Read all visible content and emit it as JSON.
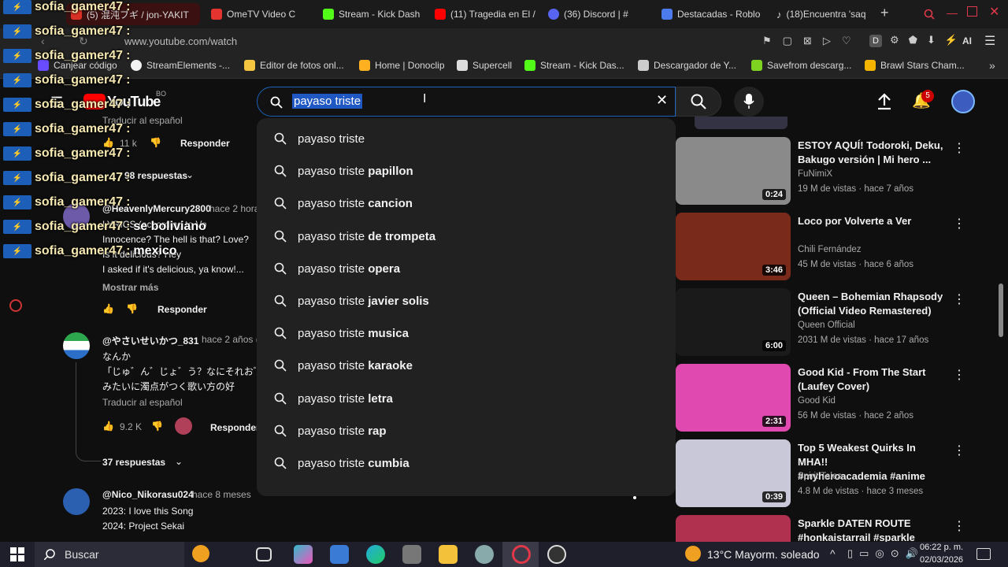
{
  "tabs": [
    {
      "label": "(5) 混沌ブギ / jon-YAKIT",
      "color": "#d93025"
    },
    {
      "label": "OmeTV Video C",
      "color": "#e3342f"
    },
    {
      "label": "Stream - Kick Dash",
      "color": "#53fc18"
    },
    {
      "label": "(11) Tragedia en El /",
      "color": "#ff0000"
    },
    {
      "label": "(36) Discord | #",
      "color": "#5865f2"
    },
    {
      "label": "Destacadas - Roblo",
      "color": "#4b7bec"
    },
    {
      "label": "(18)Encuentra 'saq",
      "color": "#111111"
    }
  ],
  "url": "www.youtube.com/watch",
  "bookmarks": [
    {
      "label": "Canjear código"
    },
    {
      "label": "StreamElements -..."
    },
    {
      "label": "Editor de fotos onl..."
    },
    {
      "label": "Home | Donoclip"
    },
    {
      "label": "Supercell"
    },
    {
      "label": "Stream - Kick Das..."
    },
    {
      "label": "Descargador de Y..."
    },
    {
      "label": "Savefrom descarg..."
    },
    {
      "label": "Brawl Stars Cham..."
    }
  ],
  "youtube": {
    "logo": "YouTube",
    "country": "BO",
    "search_value": "payaso triste",
    "notif_count": "5",
    "suggestions": [
      {
        "prefix": "payaso triste",
        "suffix": ""
      },
      {
        "prefix": "payaso triste",
        "suffix": " papillon"
      },
      {
        "prefix": "payaso triste",
        "suffix": " cancion"
      },
      {
        "prefix": "payaso triste",
        "suffix": " de trompeta"
      },
      {
        "prefix": "payaso triste",
        "suffix": " opera"
      },
      {
        "prefix": "payaso triste",
        "suffix": " javier solis"
      },
      {
        "prefix": "payaso triste",
        "suffix": " musica"
      },
      {
        "prefix": "payaso triste",
        "suffix": " karaoke"
      },
      {
        "prefix": "payaso triste",
        "suffix": " letra"
      },
      {
        "prefix": "payaso triste",
        "suffix": " rap"
      },
      {
        "prefix": "payaso triste",
        "suffix": " cumbia"
      }
    ],
    "videos": [
      {
        "title1": "ESTOY AQUÍ! Todoroki, Deku,",
        "title2": "Bakugo versión | Mi hero ...",
        "channel": "FuNimiX",
        "meta": "19 M de vistas · hace 7 años",
        "duration": "0:24",
        "thumb": "#8a8a8a"
      },
      {
        "title1": "Loco por Volverte a Ver",
        "title2": "",
        "channel": "Chili Fernández",
        "meta": "45 M de vistas · hace 6 años",
        "duration": "3:46",
        "thumb": "#7a2a1a"
      },
      {
        "title1": "Queen – Bohemian Rhapsody",
        "title2": "(Official Video Remastered)",
        "channel": "Queen Official",
        "meta": "2031 M de vistas · hace 17 años",
        "duration": "6:00",
        "thumb": "#1a1a1a"
      },
      {
        "title1": "Good Kid - From The Start",
        "title2": "(Laufey Cover)",
        "channel": "Good Kid",
        "meta": "56 M de vistas · hace 2 años",
        "duration": "2:31",
        "thumb": "#e04ab0"
      },
      {
        "title1": "Top 5 Weakest Quirks In MHA!!",
        "title2": "#myheroacademia #anime",
        "channel": "Spirit Tales",
        "meta": "4.8 M de vistas · hace 3 meses",
        "duration": "0:39",
        "thumb": "#c8c8d8"
      },
      {
        "title1": "Sparkle DATEN ROUTE",
        "title2": "#honkaistarrail #sparkle",
        "channel": "",
        "meta": "",
        "duration": "",
        "thumb": "#b03050"
      }
    ],
    "comments": {
      "reply_label": "Responder",
      "likes1": "11 k",
      "replies1": "98 respuestas",
      "c2_author": "@HeavenlyMercury2800",
      "c2_time": "hace 2 hora",
      "c2_lines": [
        "LYRICS (according to Vo",
        "Innocence? The hell is that? Love?",
        "Is it delicious? Hey",
        "I asked if it's delicious, ya know!..."
      ],
      "show_more": "Mostrar más",
      "c3_author": "@やさいせいかつ_831",
      "c3_time": "hace 2 años (e",
      "c3_lines": [
        "なんか",
        "「じゅ゛ん゛じょ゛う？なにそれおﾞ",
        "みたいに濁点がつく歌い方の好"
      ],
      "translate": "Traducir al español",
      "likes3": "9.2 K",
      "replies3": "37 respuestas",
      "c4_author": "@Nico_Nikorasu024",
      "c4_time": "hace 8 meses",
      "c4_lines": [
        "2023: I love this Song",
        "2024: Project Sekai"
      ],
      "translate_top": "Traducir al español"
    }
  },
  "chat": {
    "user": "sofia_gamer47",
    "messages": [
      "",
      "",
      "",
      "",
      "",
      "",
      "",
      "",
      "",
      "se boliviano",
      "mexico"
    ]
  },
  "taskbar": {
    "search": "Buscar",
    "weather": "13°C  Mayorm. soleado",
    "time": "06:22 p. m.",
    "date": "02/03/2026"
  }
}
